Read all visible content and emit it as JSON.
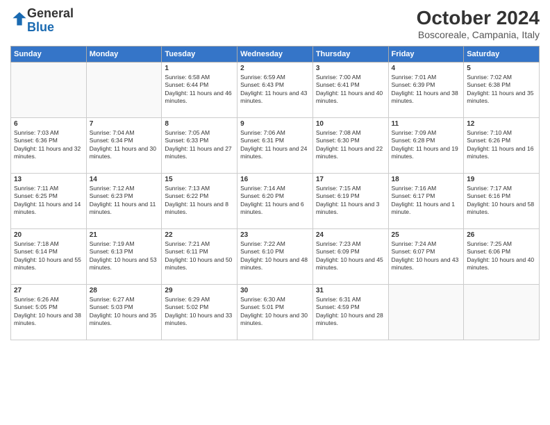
{
  "logo": {
    "general": "General",
    "blue": "Blue"
  },
  "header": {
    "month": "October 2024",
    "location": "Boscoreale, Campania, Italy"
  },
  "columns": [
    "Sunday",
    "Monday",
    "Tuesday",
    "Wednesday",
    "Thursday",
    "Friday",
    "Saturday"
  ],
  "weeks": [
    [
      {
        "day": "",
        "info": ""
      },
      {
        "day": "",
        "info": ""
      },
      {
        "day": "1",
        "info": "Sunrise: 6:58 AM\nSunset: 6:44 PM\nDaylight: 11 hours and 46 minutes."
      },
      {
        "day": "2",
        "info": "Sunrise: 6:59 AM\nSunset: 6:43 PM\nDaylight: 11 hours and 43 minutes."
      },
      {
        "day": "3",
        "info": "Sunrise: 7:00 AM\nSunset: 6:41 PM\nDaylight: 11 hours and 40 minutes."
      },
      {
        "day": "4",
        "info": "Sunrise: 7:01 AM\nSunset: 6:39 PM\nDaylight: 11 hours and 38 minutes."
      },
      {
        "day": "5",
        "info": "Sunrise: 7:02 AM\nSunset: 6:38 PM\nDaylight: 11 hours and 35 minutes."
      }
    ],
    [
      {
        "day": "6",
        "info": "Sunrise: 7:03 AM\nSunset: 6:36 PM\nDaylight: 11 hours and 32 minutes."
      },
      {
        "day": "7",
        "info": "Sunrise: 7:04 AM\nSunset: 6:34 PM\nDaylight: 11 hours and 30 minutes."
      },
      {
        "day": "8",
        "info": "Sunrise: 7:05 AM\nSunset: 6:33 PM\nDaylight: 11 hours and 27 minutes."
      },
      {
        "day": "9",
        "info": "Sunrise: 7:06 AM\nSunset: 6:31 PM\nDaylight: 11 hours and 24 minutes."
      },
      {
        "day": "10",
        "info": "Sunrise: 7:08 AM\nSunset: 6:30 PM\nDaylight: 11 hours and 22 minutes."
      },
      {
        "day": "11",
        "info": "Sunrise: 7:09 AM\nSunset: 6:28 PM\nDaylight: 11 hours and 19 minutes."
      },
      {
        "day": "12",
        "info": "Sunrise: 7:10 AM\nSunset: 6:26 PM\nDaylight: 11 hours and 16 minutes."
      }
    ],
    [
      {
        "day": "13",
        "info": "Sunrise: 7:11 AM\nSunset: 6:25 PM\nDaylight: 11 hours and 14 minutes."
      },
      {
        "day": "14",
        "info": "Sunrise: 7:12 AM\nSunset: 6:23 PM\nDaylight: 11 hours and 11 minutes."
      },
      {
        "day": "15",
        "info": "Sunrise: 7:13 AM\nSunset: 6:22 PM\nDaylight: 11 hours and 8 minutes."
      },
      {
        "day": "16",
        "info": "Sunrise: 7:14 AM\nSunset: 6:20 PM\nDaylight: 11 hours and 6 minutes."
      },
      {
        "day": "17",
        "info": "Sunrise: 7:15 AM\nSunset: 6:19 PM\nDaylight: 11 hours and 3 minutes."
      },
      {
        "day": "18",
        "info": "Sunrise: 7:16 AM\nSunset: 6:17 PM\nDaylight: 11 hours and 1 minute."
      },
      {
        "day": "19",
        "info": "Sunrise: 7:17 AM\nSunset: 6:16 PM\nDaylight: 10 hours and 58 minutes."
      }
    ],
    [
      {
        "day": "20",
        "info": "Sunrise: 7:18 AM\nSunset: 6:14 PM\nDaylight: 10 hours and 55 minutes."
      },
      {
        "day": "21",
        "info": "Sunrise: 7:19 AM\nSunset: 6:13 PM\nDaylight: 10 hours and 53 minutes."
      },
      {
        "day": "22",
        "info": "Sunrise: 7:21 AM\nSunset: 6:11 PM\nDaylight: 10 hours and 50 minutes."
      },
      {
        "day": "23",
        "info": "Sunrise: 7:22 AM\nSunset: 6:10 PM\nDaylight: 10 hours and 48 minutes."
      },
      {
        "day": "24",
        "info": "Sunrise: 7:23 AM\nSunset: 6:09 PM\nDaylight: 10 hours and 45 minutes."
      },
      {
        "day": "25",
        "info": "Sunrise: 7:24 AM\nSunset: 6:07 PM\nDaylight: 10 hours and 43 minutes."
      },
      {
        "day": "26",
        "info": "Sunrise: 7:25 AM\nSunset: 6:06 PM\nDaylight: 10 hours and 40 minutes."
      }
    ],
    [
      {
        "day": "27",
        "info": "Sunrise: 6:26 AM\nSunset: 5:05 PM\nDaylight: 10 hours and 38 minutes."
      },
      {
        "day": "28",
        "info": "Sunrise: 6:27 AM\nSunset: 5:03 PM\nDaylight: 10 hours and 35 minutes."
      },
      {
        "day": "29",
        "info": "Sunrise: 6:29 AM\nSunset: 5:02 PM\nDaylight: 10 hours and 33 minutes."
      },
      {
        "day": "30",
        "info": "Sunrise: 6:30 AM\nSunset: 5:01 PM\nDaylight: 10 hours and 30 minutes."
      },
      {
        "day": "31",
        "info": "Sunrise: 6:31 AM\nSunset: 4:59 PM\nDaylight: 10 hours and 28 minutes."
      },
      {
        "day": "",
        "info": ""
      },
      {
        "day": "",
        "info": ""
      }
    ]
  ]
}
